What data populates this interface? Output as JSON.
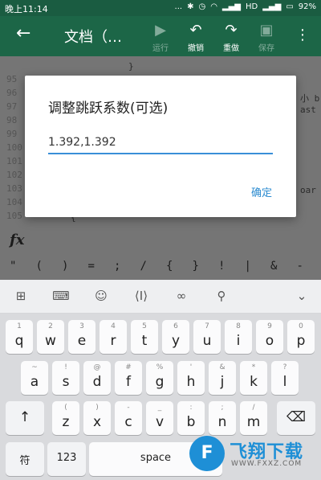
{
  "status_bar": {
    "time": "晚上11:14",
    "signal_text": "...",
    "network": "HD",
    "battery": "92%"
  },
  "toolbar": {
    "title": "文档（…",
    "run_label": "运行",
    "undo_label": "撤销",
    "redo_label": "重做",
    "save_label": "保存"
  },
  "editor": {
    "line_numbers": [
      "95",
      "96",
      "97",
      "98",
      "99",
      "100",
      "101",
      "102",
      "103",
      "104",
      "105",
      "106"
    ],
    "fragments": [
      "}",
      "小 b",
      "ast",
      "oar",
      "{"
    ]
  },
  "dialog": {
    "title": "调整跳跃系数(可选)",
    "input_value": "1.392,1.392",
    "confirm_label": "确定"
  },
  "fx_label": "fx",
  "symbols": [
    "\"",
    "(",
    ")",
    "=",
    ";",
    "/",
    "{",
    "}",
    "!",
    "|",
    "&",
    "-"
  ],
  "keyboard": {
    "row1": [
      {
        "hint": "1",
        "key": "q"
      },
      {
        "hint": "2",
        "key": "w"
      },
      {
        "hint": "3",
        "key": "e"
      },
      {
        "hint": "4",
        "key": "r"
      },
      {
        "hint": "5",
        "key": "t"
      },
      {
        "hint": "6",
        "key": "y"
      },
      {
        "hint": "7",
        "key": "u"
      },
      {
        "hint": "8",
        "key": "i"
      },
      {
        "hint": "9",
        "key": "o"
      },
      {
        "hint": "0",
        "key": "p"
      }
    ],
    "row2": [
      {
        "hint": "~",
        "key": "a"
      },
      {
        "hint": "!",
        "key": "s"
      },
      {
        "hint": "@",
        "key": "d"
      },
      {
        "hint": "#",
        "key": "f"
      },
      {
        "hint": "%",
        "key": "g"
      },
      {
        "hint": "'",
        "key": "h"
      },
      {
        "hint": "&",
        "key": "j"
      },
      {
        "hint": "*",
        "key": "k"
      },
      {
        "hint": "?",
        "key": "l"
      }
    ],
    "row3": [
      {
        "hint": "(",
        "key": "z"
      },
      {
        "hint": ")",
        "key": "x"
      },
      {
        "hint": "-",
        "key": "c"
      },
      {
        "hint": "_",
        "key": "v"
      },
      {
        "hint": ":",
        "key": "b"
      },
      {
        "hint": ";",
        "key": "n"
      },
      {
        "hint": "/",
        "key": "m"
      }
    ],
    "symbol_key": "符",
    "num_key": "123",
    "space_key": "space"
  },
  "watermark": {
    "brand": "飞翔下载",
    "url": "WWW.FXXZ.COM"
  }
}
